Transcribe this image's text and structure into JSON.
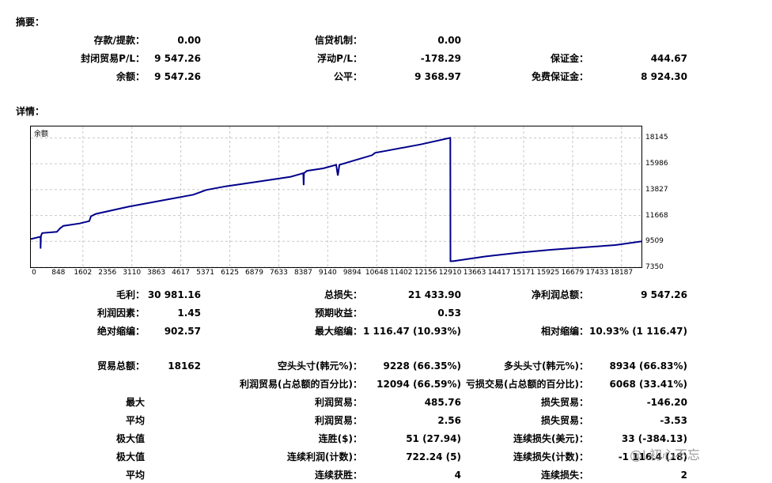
{
  "summary": {
    "title": "摘要：",
    "rows": [
      {
        "l1": "存款/提款：",
        "v1": "0.00",
        "l2": "信贷机制：",
        "v2": "0.00",
        "l3": "",
        "v3": ""
      },
      {
        "l1": "封闭贸易P/L：",
        "v1": "9 547.26",
        "l2": "浮动P/L：",
        "v2": "-178.29",
        "l3": "保证金：",
        "v3": "444.67"
      },
      {
        "l1": "余额：",
        "v1": "9 547.26",
        "l2": "公平：",
        "v2": "9 368.97",
        "l3": "免费保证金：",
        "v3": "8 924.30"
      }
    ]
  },
  "details": {
    "title": "详情：",
    "rows1": [
      {
        "l1": "毛利：",
        "v1": "30 981.16",
        "l2": "总损失：",
        "v2": "21 433.90",
        "l3": "净利润总额：",
        "v3": "9 547.26"
      },
      {
        "l1": "利润因素：",
        "v1": "1.45",
        "l2": "预期收益：",
        "v2": "0.53",
        "l3": "",
        "v3": ""
      },
      {
        "l1": "绝对缩编：",
        "v1": "902.57",
        "l2": "最大缩编：",
        "v2": "1 116.47 (10.93%)",
        "l3": "相对缩编：",
        "v3": "10.93% (1 116.47)"
      }
    ],
    "rows2": [
      {
        "l1": "贸易总额：",
        "v1": "18162",
        "l2": "空头头寸(韩元%)：",
        "v2": "9228 (66.35%)",
        "l3": "多头头寸(韩元%)：",
        "v3": "8934 (66.83%)"
      },
      {
        "l1": "",
        "v1": "",
        "l2": "利润贸易(占总额的百分比)：",
        "v2": "12094 (66.59%)",
        "l3": "亏损交易(占总额的百分比)：",
        "v3": "6068 (33.41%)"
      },
      {
        "l1": "最大",
        "v1": "",
        "l2": "利润贸易：",
        "v2": "485.76",
        "l3": "损失贸易：",
        "v3": "-146.20"
      },
      {
        "l1": "平均",
        "v1": "",
        "l2": "利润贸易：",
        "v2": "2.56",
        "l3": "损失贸易：",
        "v3": "-3.53"
      },
      {
        "l1": "极大值",
        "v1": "",
        "l2": "连胜($)：",
        "v2": "51 (27.94)",
        "l3": "连续损失(美元)：",
        "v3": "33 (-384.13)"
      },
      {
        "l1": "极大值",
        "v1": "",
        "l2": "连续利润(计数)：",
        "v2": "722.24 (5)",
        "l3": "连续损失(计数)：",
        "v3": "-1 116.4  (18)"
      },
      {
        "l1": "平均",
        "v1": "",
        "l2": "连续获胜：",
        "v2": "4",
        "l3": "连续损失：",
        "v3": "2"
      }
    ]
  },
  "watermark": "@L初心不忘",
  "chart_data": {
    "type": "line",
    "title": "",
    "series_label": "余额",
    "line_color": "#00008b",
    "grid": true,
    "xlim": [
      0,
      18800
    ],
    "ylim": [
      7350,
      19100
    ],
    "x_ticks": [
      0,
      848,
      1602,
      2356,
      3110,
      3863,
      4617,
      5371,
      6125,
      6879,
      7633,
      8387,
      9140,
      9894,
      10648,
      11402,
      12156,
      12910,
      13663,
      14417,
      15171,
      15925,
      16679,
      17433,
      18187
    ],
    "y_ticks": [
      7350,
      9509,
      11668,
      13827,
      15986,
      18145
    ],
    "series": [
      {
        "x": [
          0,
          300,
          300,
          310,
          330,
          350,
          800,
          900,
          1000,
          1500,
          1800,
          1850,
          2000,
          3000,
          4000,
          5000,
          5300,
          5400,
          6000,
          7000,
          8000,
          8387,
          8400,
          8410,
          8500,
          9000,
          9400,
          9450,
          9500,
          10000,
          10500,
          10600,
          11000,
          12000,
          12910,
          12915,
          12920,
          13000,
          14000,
          15000,
          16000,
          17000,
          18000,
          18800
        ],
        "y": [
          9700,
          9900,
          8900,
          9900,
          10100,
          10200,
          10300,
          10600,
          10800,
          11000,
          11200,
          11600,
          11800,
          12400,
          12900,
          13400,
          13700,
          13800,
          14100,
          14500,
          14900,
          15200,
          14200,
          15200,
          15400,
          15600,
          15900,
          15000,
          15900,
          16300,
          16700,
          16900,
          17100,
          17600,
          18150,
          18150,
          7850,
          7850,
          8250,
          8550,
          8800,
          9000,
          9200,
          9500
        ]
      }
    ]
  }
}
